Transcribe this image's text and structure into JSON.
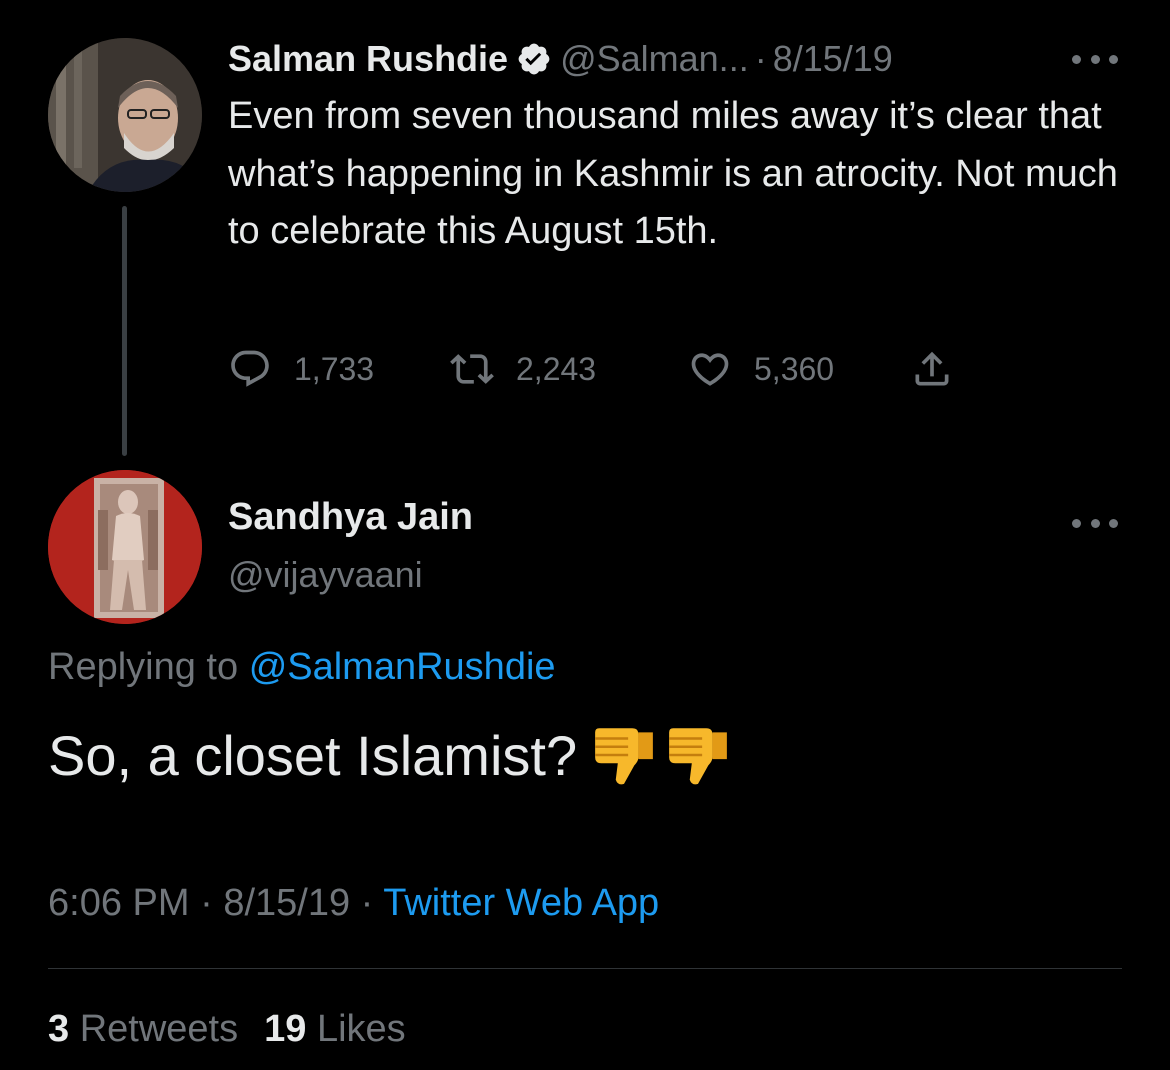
{
  "parent_tweet": {
    "display_name": "Salman Rushdie",
    "handle": "@Salman...",
    "date": "8/15/19",
    "text": "Even from seven thousand miles away it’s clear that what’s happening in Kashmir is an atrocity. Not much to celebrate this August 15th.",
    "reply_count": "1,733",
    "retweet_count": "2,243",
    "like_count": "5,360",
    "verified": true
  },
  "reply_tweet": {
    "display_name": "Sandhya Jain",
    "handle": "@vijayvaani",
    "replying_to_label": "Replying to",
    "replying_to_handle": "@SalmanRushdie",
    "text": "So, a closet Islamist?",
    "emoji": [
      "thumbs-down",
      "thumbs-down"
    ],
    "time": "6:06 PM",
    "date": "8/15/19",
    "source": "Twitter Web App",
    "retweets_count": "3",
    "retweets_label": "Retweets",
    "likes_count": "19",
    "likes_label": "Likes"
  },
  "separator": "·",
  "colors": {
    "background": "#000000",
    "primary_text": "#e7e9ea",
    "secondary_text": "#71767b",
    "link": "#1d9bf0",
    "divider": "#2f3336",
    "thread_line": "#3a3f43"
  },
  "icons": {
    "verified": "verified-badge-icon",
    "more": "more-horizontal-icon",
    "reply": "reply-bubble-icon",
    "retweet": "retweet-icon",
    "like": "heart-icon",
    "share": "share-upload-icon",
    "emoji": "thumbs-down-emoji"
  }
}
